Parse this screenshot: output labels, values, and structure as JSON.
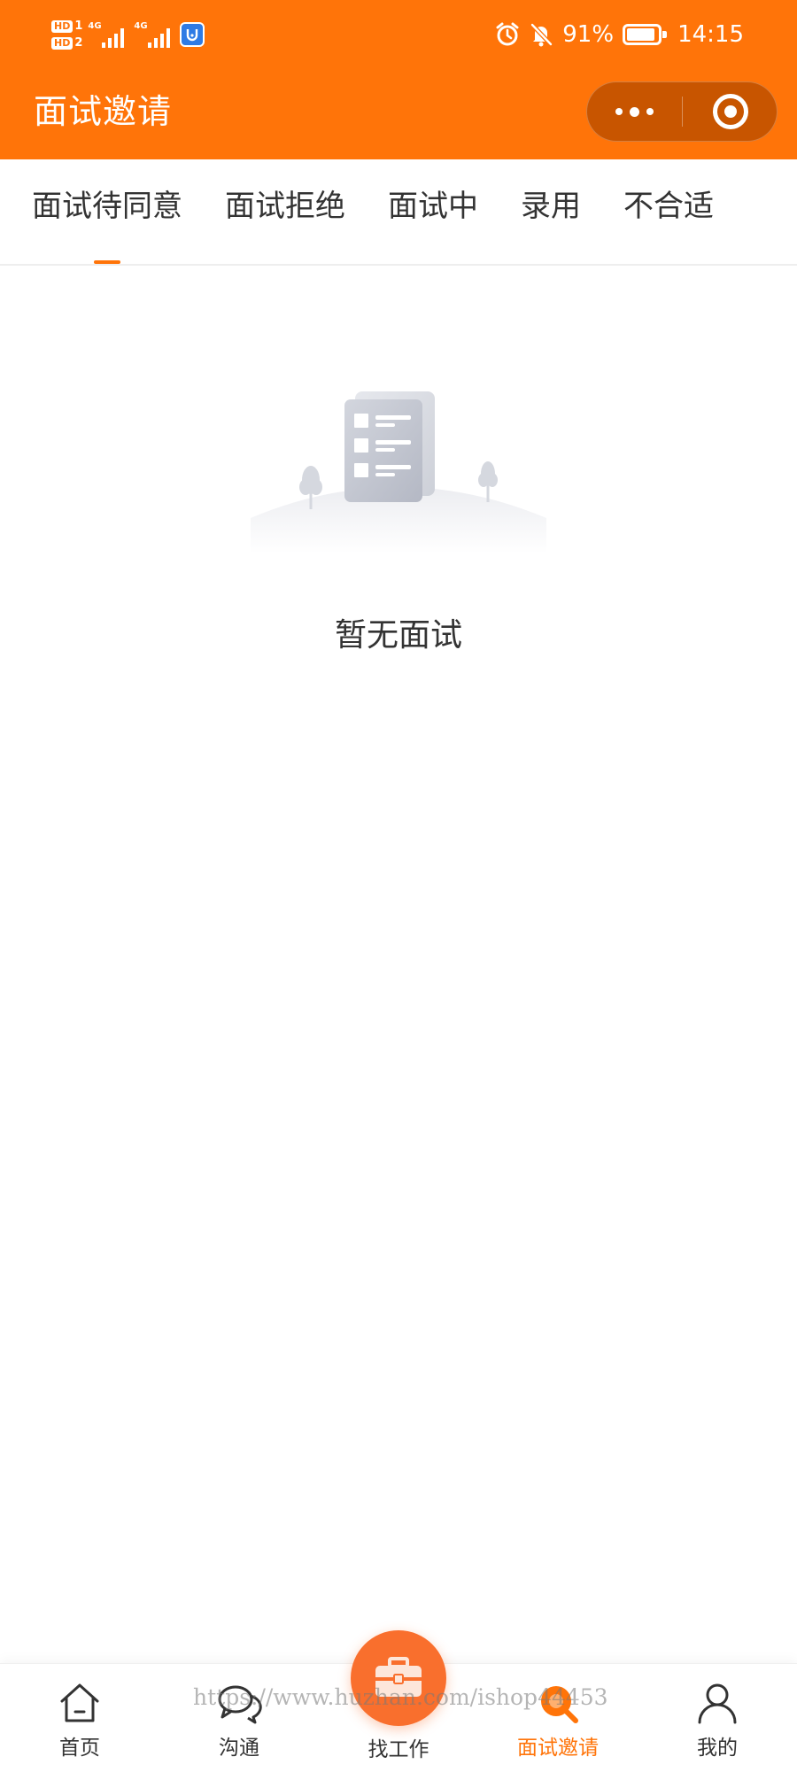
{
  "status_bar": {
    "sim1": "1",
    "sim2": "2",
    "hd_label": "HD",
    "network1": "4G",
    "network2": "4G",
    "battery_percent": "91%",
    "battery_level": 0.91,
    "time": "14:15",
    "icons": [
      "signal-icon",
      "app-notification-icon",
      "alarm-icon",
      "mute-icon",
      "battery-icon"
    ]
  },
  "nav": {
    "title": "面试邀请",
    "more_icon": "more-dots-icon",
    "close_icon": "target-circle-icon"
  },
  "tabs": [
    {
      "label": "面试待同意",
      "active": true
    },
    {
      "label": "面试拒绝",
      "active": false
    },
    {
      "label": "面试中",
      "active": false
    },
    {
      "label": "录用",
      "active": false
    },
    {
      "label": "不合适",
      "active": false
    }
  ],
  "empty_state": {
    "icon": "empty-document-icon",
    "text": "暂无面试"
  },
  "tabbar": {
    "items": [
      {
        "label": "首页",
        "icon": "home-icon",
        "active": false
      },
      {
        "label": "沟通",
        "icon": "chat-icon",
        "active": false
      },
      {
        "label": "找工作",
        "icon": "briefcase-icon",
        "active": false
      },
      {
        "label": "面试邀请",
        "icon": "interview-icon",
        "active": true
      },
      {
        "label": "我的",
        "icon": "user-icon",
        "active": false
      }
    ]
  },
  "watermark": "https://www.huzhan.com/ishop44453",
  "colors": {
    "primary": "#FF7409",
    "capsule": "#C85500",
    "center_button": "#F96F2D",
    "text": "#333333",
    "divider": "#EEEEEE"
  }
}
